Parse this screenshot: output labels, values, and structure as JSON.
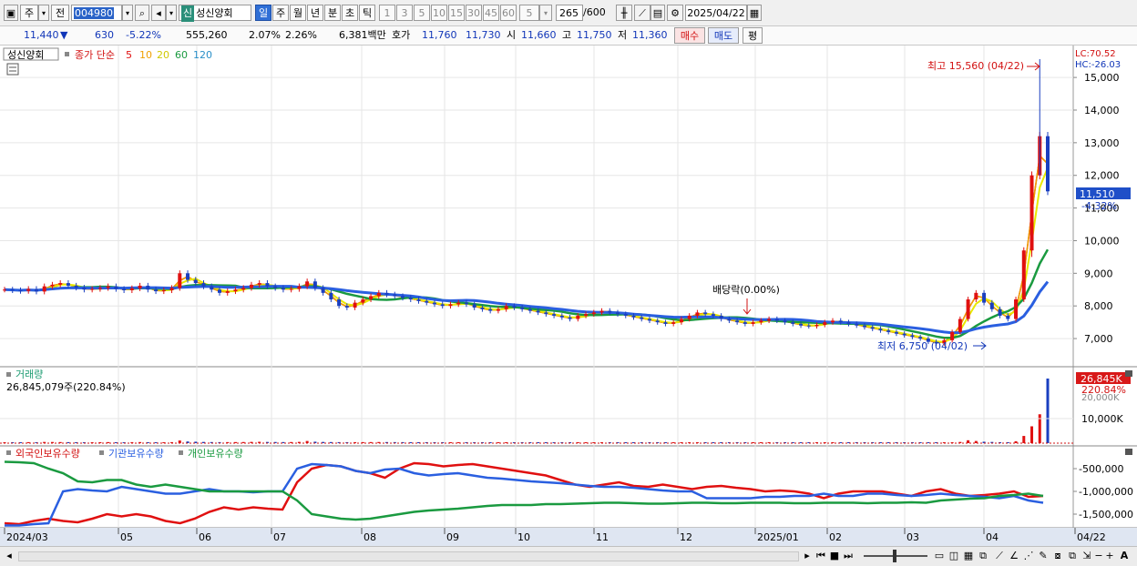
{
  "toolbar": {
    "tab_main": "주",
    "tab_prev": "전",
    "code": "004980",
    "stock_badge": "신",
    "stock_name": "성신양회",
    "periods": [
      "일",
      "주",
      "월",
      "년",
      "분",
      "초",
      "틱"
    ],
    "active_period": "일",
    "intervals": [
      "1",
      "3",
      "5",
      "10",
      "15",
      "30",
      "45",
      "60"
    ],
    "interval_value": "5",
    "count_value": "265",
    "count_total": "/600",
    "date_value": "2025/04/22"
  },
  "info": {
    "price": "11,440",
    "change": "630",
    "change_pct": "-5.22%",
    "volume": "555,260",
    "vol_ratio": "2.07%",
    "turnover": "2.26%",
    "amount": "6,381백만",
    "ask_label": "호가",
    "ask1": "11,760",
    "ask2": "11,730",
    "open_label": "시",
    "open": "11,660",
    "high_label": "고",
    "high": "11,750",
    "low_label": "저",
    "low": "11,360",
    "buy_label": "매수",
    "sell_label": "매도",
    "eval_label": "평"
  },
  "chart_data": [
    {
      "type": "candlestick",
      "panel": "price",
      "title": "성신양회",
      "legend": {
        "price_label": "종가 단순",
        "ma_periods": [
          "5",
          "10",
          "20",
          "60",
          "120"
        ],
        "ma_colors": [
          "#e01010",
          "#f0a000",
          "#e8e800",
          "#1a9a40",
          "#2a5fe0"
        ]
      },
      "y_ticks": [
        "15,000",
        "14,000",
        "13,000",
        "12,000",
        "11,000",
        "10,000",
        "9,000",
        "8,000",
        "7,000"
      ],
      "ylim": [
        6500,
        15700
      ],
      "x_labels": [
        "2024/03",
        "05",
        "06",
        "07",
        "08",
        "09",
        "10",
        "11",
        "12",
        "2025/01",
        "02",
        "03",
        "04",
        "04/22"
      ],
      "annotations": {
        "high": "최고 15,560 (04/22)",
        "low": "최저 6,750 (04/02)",
        "dividend": "배당락(0.00%)"
      },
      "lc": "LC:70.52",
      "hc": "HC:-26.03",
      "last_price_label": "11,510",
      "last_change_label": "-4.32%",
      "closes": [
        8500,
        8480,
        8460,
        8520,
        8440,
        8600,
        8650,
        8700,
        8620,
        8560,
        8500,
        8520,
        8550,
        8600,
        8520,
        8480,
        8540,
        8620,
        8500,
        8450,
        8480,
        8550,
        9000,
        8800,
        8700,
        8600,
        8500,
        8400,
        8450,
        8500,
        8550,
        8650,
        8700,
        8600,
        8550,
        8500,
        8520,
        8600,
        8750,
        8550,
        8400,
        8200,
        8000,
        7950,
        8100,
        8200,
        8300,
        8400,
        8350,
        8300,
        8250,
        8200,
        8150,
        8100,
        8050,
        8000,
        8050,
        8100,
        8050,
        7950,
        7900,
        7850,
        7900,
        8000,
        7950,
        7900,
        7850,
        7800,
        7750,
        7700,
        7650,
        7600,
        7700,
        7750,
        7800,
        7850,
        7800,
        7750,
        7700,
        7650,
        7600,
        7550,
        7500,
        7450,
        7500,
        7600,
        7700,
        7800,
        7750,
        7700,
        7600,
        7550,
        7500,
        7450,
        7500,
        7550,
        7600,
        7550,
        7500,
        7450,
        7400,
        7380,
        7420,
        7500,
        7550,
        7500,
        7450,
        7400,
        7350,
        7300,
        7250,
        7200,
        7150,
        7100,
        7050,
        7000,
        6900,
        6850,
        6950,
        7200,
        7600,
        8200,
        8400,
        8100,
        7900,
        7700,
        7600,
        8200,
        9700,
        12000,
        13200,
        11510
      ],
      "volumes_k": [
        400,
        380,
        360,
        420,
        350,
        500,
        480,
        450,
        420,
        400,
        380,
        390,
        410,
        430,
        400,
        380,
        420,
        450,
        400,
        380,
        390,
        420,
        1100,
        700,
        600,
        500,
        450,
        420,
        430,
        450,
        470,
        520,
        560,
        500,
        480,
        450,
        460,
        520,
        900,
        600,
        500,
        450,
        420,
        400,
        420,
        430,
        450,
        470,
        450,
        430,
        420,
        410,
        400,
        390,
        380,
        370,
        380,
        390,
        380,
        370,
        360,
        350,
        360,
        380,
        370,
        360,
        350,
        340,
        330,
        320,
        310,
        300,
        320,
        330,
        340,
        350,
        340,
        330,
        320,
        310,
        300,
        290,
        280,
        270,
        280,
        300,
        320,
        340,
        330,
        320,
        300,
        290,
        280,
        270,
        280,
        290,
        300,
        290,
        280,
        270,
        260,
        250,
        260,
        280,
        290,
        280,
        270,
        260,
        250,
        240,
        230,
        220,
        210,
        200,
        190,
        180,
        170,
        160,
        200,
        300,
        500,
        1200,
        900,
        600,
        500,
        400,
        350,
        800,
        3000,
        7000,
        12000,
        26845
      ],
      "volume_label": "거래량",
      "volume_value": "26,845,079주(220.84%)",
      "volume_tick": "10,000K",
      "volume_badge": "26,845K",
      "volume_badge_pct": "220.84%",
      "volume_cut_label": "20,000K"
    },
    {
      "type": "line",
      "panel": "holdings",
      "legend": [
        "외국인보유수량",
        "기관보유수량",
        "개인보유수량"
      ],
      "colors": [
        "#e01010",
        "#2a5fe0",
        "#1a9a40"
      ],
      "y_ticks": [
        "-500,000",
        "-1,000,000",
        "-1,500,000"
      ],
      "ylim": [
        -1800000,
        -200000
      ],
      "series": [
        {
          "name": "외국인보유수량",
          "values": [
            -1700000,
            -1720000,
            -1650000,
            -1600000,
            -1650000,
            -1680000,
            -1600000,
            -1500000,
            -1550000,
            -1500000,
            -1550000,
            -1650000,
            -1700000,
            -1600000,
            -1450000,
            -1350000,
            -1400000,
            -1350000,
            -1380000,
            -1400000,
            -800000,
            -500000,
            -420000,
            -450000,
            -550000,
            -600000,
            -700000,
            -500000,
            -380000,
            -400000,
            -450000,
            -420000,
            -400000,
            -450000,
            -500000,
            -550000,
            -600000,
            -650000,
            -750000,
            -850000,
            -900000,
            -850000,
            -800000,
            -880000,
            -900000,
            -850000,
            -900000,
            -950000,
            -900000,
            -880000,
            -920000,
            -950000,
            -1000000,
            -980000,
            -1000000,
            -1050000,
            -1150000,
            -1050000,
            -1000000,
            -1000000,
            -1000000,
            -1050000,
            -1100000,
            -1000000,
            -950000,
            -1050000,
            -1100000,
            -1080000,
            -1050000,
            -1000000,
            -1120000,
            -1100000
          ]
        },
        {
          "name": "기관보유수량",
          "values": [
            -1750000,
            -1750000,
            -1720000,
            -1700000,
            -1000000,
            -950000,
            -980000,
            -1000000,
            -900000,
            -950000,
            -1000000,
            -1050000,
            -1050000,
            -1000000,
            -950000,
            -1000000,
            -1000000,
            -1020000,
            -1000000,
            -1000000,
            -500000,
            -400000,
            -420000,
            -450000,
            -550000,
            -600000,
            -520000,
            -500000,
            -600000,
            -650000,
            -620000,
            -600000,
            -650000,
            -700000,
            -720000,
            -750000,
            -780000,
            -800000,
            -820000,
            -850000,
            -880000,
            -900000,
            -900000,
            -920000,
            -950000,
            -980000,
            -1000000,
            -1000000,
            -1150000,
            -1150000,
            -1150000,
            -1150000,
            -1120000,
            -1120000,
            -1100000,
            -1100000,
            -1050000,
            -1100000,
            -1100000,
            -1050000,
            -1050000,
            -1080000,
            -1100000,
            -1080000,
            -1050000,
            -1080000,
            -1100000,
            -1120000,
            -1150000,
            -1100000,
            -1200000,
            -1250000
          ]
        },
        {
          "name": "개인보유수량",
          "values": [
            -350000,
            -360000,
            -380000,
            -500000,
            -600000,
            -780000,
            -800000,
            -750000,
            -750000,
            -850000,
            -900000,
            -850000,
            -900000,
            -950000,
            -1000000,
            -1000000,
            -1000000,
            -1000000,
            -1000000,
            -1000000,
            -1200000,
            -1500000,
            -1550000,
            -1600000,
            -1620000,
            -1600000,
            -1550000,
            -1500000,
            -1450000,
            -1420000,
            -1400000,
            -1380000,
            -1350000,
            -1320000,
            -1300000,
            -1300000,
            -1300000,
            -1280000,
            -1280000,
            -1270000,
            -1260000,
            -1250000,
            -1250000,
            -1260000,
            -1270000,
            -1270000,
            -1260000,
            -1250000,
            -1250000,
            -1260000,
            -1260000,
            -1250000,
            -1250000,
            -1250000,
            -1260000,
            -1260000,
            -1250000,
            -1250000,
            -1250000,
            -1260000,
            -1250000,
            -1250000,
            -1240000,
            -1250000,
            -1200000,
            -1180000,
            -1160000,
            -1150000,
            -1100000,
            -1080000,
            -1050000,
            -1100000
          ]
        }
      ]
    }
  ],
  "statusbar": {
    "left_arrow": "◂"
  }
}
